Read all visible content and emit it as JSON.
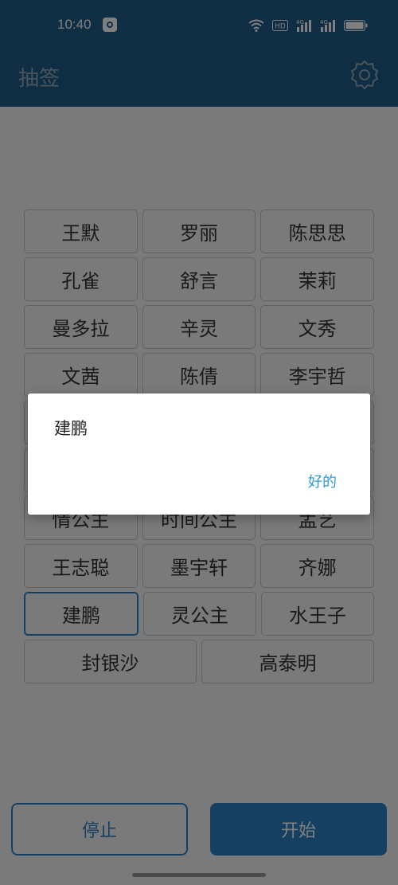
{
  "status_bar": {
    "time": "10:40",
    "hd_badge": "HD",
    "network_1": "4G",
    "network_2": "4G",
    "icons": [
      "app-notification-icon",
      "wifi-icon",
      "hd-icon",
      "signal-4g-icon",
      "signal-4g-icon",
      "battery-icon"
    ]
  },
  "app_bar": {
    "title": "抽签",
    "settings_icon": "gear-icon"
  },
  "names": {
    "rows": [
      [
        "王默",
        "罗丽",
        "陈思思"
      ],
      [
        "孔雀",
        "舒言",
        "茉莉"
      ],
      [
        "曼多拉",
        "辛灵",
        "文秀"
      ],
      [
        "文茜",
        "陈倩",
        "李宇哲"
      ],
      [
        "",
        "",
        ""
      ],
      [
        "",
        "",
        ""
      ],
      [
        "情公主",
        "时间公主",
        "孟艺"
      ],
      [
        "王志聪",
        "墨宇轩",
        "齐娜"
      ],
      [
        "建鹏",
        "灵公主",
        "水王子"
      ],
      [
        "封银沙",
        "高泰明"
      ]
    ],
    "selected": "建鹏"
  },
  "buttons": {
    "stop_label": "停止",
    "start_label": "开始"
  },
  "dialog": {
    "message": "建鹏",
    "ok_label": "好的"
  },
  "colors": {
    "primary": "#1f5c86",
    "accent": "#2c80c5",
    "dialog_ok": "#2c9ad6"
  }
}
